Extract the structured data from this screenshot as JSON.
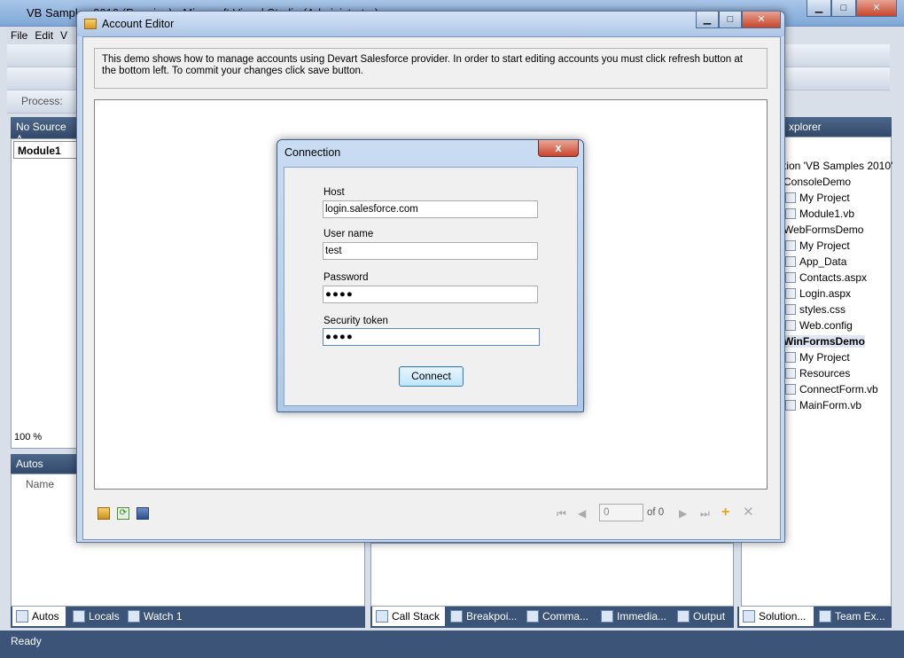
{
  "vs": {
    "title": "VB Samples 2010 (Running) - Microsoft Visual Studio (Administrator)",
    "menu": [
      "File",
      "Edit",
      "V"
    ],
    "process_label": "Process:",
    "no_source_label": "No Source A",
    "doc_tab": "Module1",
    "zoom": "100 %",
    "autos_title": "Autos",
    "autos_col": "Name",
    "status": "Ready",
    "bottom_tabs_left": [
      "Autos",
      "Locals",
      "Watch 1"
    ],
    "bottom_tabs_right": [
      "Call Stack",
      "Breakpoi...",
      "Comma...",
      "Immedia...",
      "Output"
    ],
    "bottom_tabs_sol": [
      "Solution...",
      "Team Ex..."
    ],
    "solution": {
      "title": "xplorer",
      "items": [
        {
          "label": "tion 'VB Samples 2010'",
          "bold": false,
          "indent": 0
        },
        {
          "label": "ConsoleDemo",
          "bold": false,
          "indent": 0
        },
        {
          "label": "My Project",
          "bold": false,
          "indent": 1
        },
        {
          "label": "Module1.vb",
          "bold": false,
          "indent": 1
        },
        {
          "label": "WebFormsDemo",
          "bold": false,
          "indent": 0
        },
        {
          "label": "My Project",
          "bold": false,
          "indent": 1
        },
        {
          "label": "App_Data",
          "bold": false,
          "indent": 1
        },
        {
          "label": "Contacts.aspx",
          "bold": false,
          "indent": 1
        },
        {
          "label": "Login.aspx",
          "bold": false,
          "indent": 1
        },
        {
          "label": "styles.css",
          "bold": false,
          "indent": 1
        },
        {
          "label": "Web.config",
          "bold": false,
          "indent": 1
        },
        {
          "label": "WinFormsDemo",
          "bold": true,
          "indent": 0
        },
        {
          "label": "My Project",
          "bold": false,
          "indent": 1
        },
        {
          "label": "Resources",
          "bold": false,
          "indent": 1
        },
        {
          "label": "ConnectForm.vb",
          "bold": false,
          "indent": 1
        },
        {
          "label": "MainForm.vb",
          "bold": false,
          "indent": 1
        }
      ]
    }
  },
  "editor": {
    "title": "Account Editor",
    "info": "This demo shows how to manage accounts using Devart Salesforce provider. In order to start editing accounts you must click refresh button at the bottom left. To commit your changes click save button.",
    "position_value": "0",
    "of_label": "of 0"
  },
  "connection": {
    "title": "Connection",
    "close_glyph": "x",
    "host_label": "Host",
    "host_value": "login.salesforce.com",
    "user_label": "User name",
    "user_value": "test",
    "password_label": "Password",
    "password_value": "●●●●",
    "token_label": "Security token",
    "token_value": "●●●●",
    "connect_label": "Connect"
  }
}
